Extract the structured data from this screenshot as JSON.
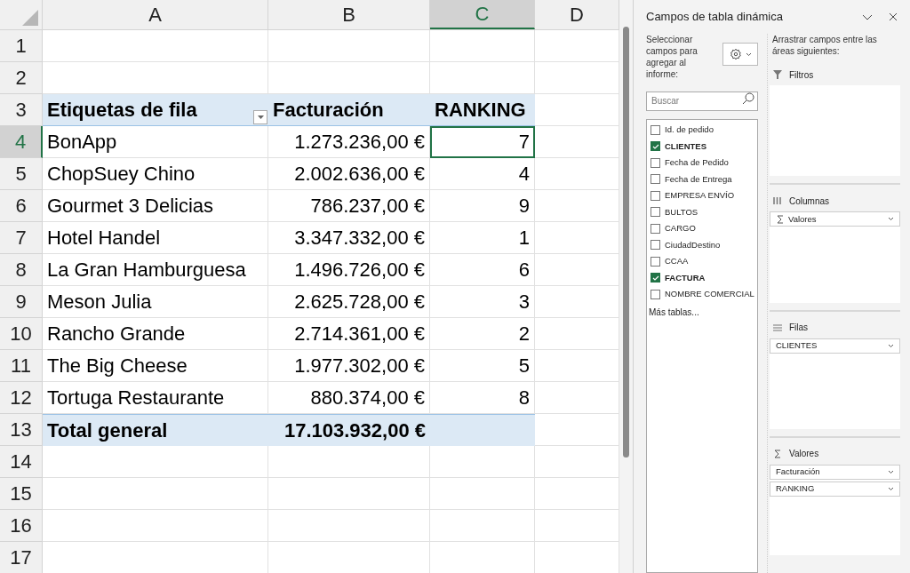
{
  "sheet": {
    "columns": [
      {
        "label": "A",
        "selected": false
      },
      {
        "label": "B",
        "selected": false
      },
      {
        "label": "C",
        "selected": true
      },
      {
        "label": "D",
        "selected": false
      }
    ],
    "rows": [
      {
        "number": "1",
        "kind": "empty",
        "selected": false
      },
      {
        "number": "2",
        "kind": "empty",
        "selected": false
      },
      {
        "number": "3",
        "kind": "header",
        "selected": false,
        "cells": [
          "Etiquetas de fila",
          "Facturación",
          "RANKING"
        ]
      },
      {
        "number": "4",
        "kind": "data",
        "selected": true,
        "cells": [
          "BonApp",
          "1.273.236,00 €",
          "7"
        ]
      },
      {
        "number": "5",
        "kind": "data",
        "selected": false,
        "cells": [
          "ChopSuey Chino",
          "2.002.636,00 €",
          "4"
        ]
      },
      {
        "number": "6",
        "kind": "data",
        "selected": false,
        "cells": [
          "Gourmet 3 Delicias",
          "786.237,00 €",
          "9"
        ]
      },
      {
        "number": "7",
        "kind": "data",
        "selected": false,
        "cells": [
          "Hotel Handel",
          "3.347.332,00 €",
          "1"
        ]
      },
      {
        "number": "8",
        "kind": "data",
        "selected": false,
        "cells": [
          "La Gran Hamburguesa",
          "1.496.726,00 €",
          "6"
        ]
      },
      {
        "number": "9",
        "kind": "data",
        "selected": false,
        "cells": [
          "Meson Julia",
          "2.625.728,00 €",
          "3"
        ]
      },
      {
        "number": "10",
        "kind": "data",
        "selected": false,
        "cells": [
          "Rancho Grande",
          "2.714.361,00 €",
          "2"
        ]
      },
      {
        "number": "11",
        "kind": "data",
        "selected": false,
        "cells": [
          "The Big Cheese",
          "1.977.302,00 €",
          "5"
        ]
      },
      {
        "number": "12",
        "kind": "data",
        "selected": false,
        "cells": [
          "Tortuga Restaurante",
          "880.374,00 €",
          "8"
        ]
      },
      {
        "number": "13",
        "kind": "total",
        "selected": false,
        "cells": [
          "Total general",
          "17.103.932,00 €",
          ""
        ]
      },
      {
        "number": "14",
        "kind": "empty",
        "selected": false
      },
      {
        "number": "15",
        "kind": "empty",
        "selected": false
      },
      {
        "number": "16",
        "kind": "empty",
        "selected": false
      },
      {
        "number": "17",
        "kind": "empty",
        "selected": false
      }
    ]
  },
  "pivot_pane": {
    "title": "Campos de tabla dinámica",
    "select_prompt": "Seleccionar campos para agregar al informe:",
    "search": {
      "placeholder": "Buscar"
    },
    "fields": [
      {
        "label": "Id. de pedido",
        "checked": false
      },
      {
        "label": "CLIENTES",
        "checked": true
      },
      {
        "label": "Fecha de Pedido",
        "checked": false
      },
      {
        "label": "Fecha de Entrega",
        "checked": false
      },
      {
        "label": "EMPRESA ENVÍO",
        "checked": false
      },
      {
        "label": "BULTOS",
        "checked": false
      },
      {
        "label": "CARGO",
        "checked": false
      },
      {
        "label": "CiudadDestino",
        "checked": false
      },
      {
        "label": "CCAA",
        "checked": false
      },
      {
        "label": "FACTURA",
        "checked": true
      },
      {
        "label": "NOMBRE COMERCIAL",
        "checked": false
      }
    ],
    "more_tables": "Más tablas...",
    "drag_prompt": "Arrastrar campos entre las áreas siguientes:",
    "areas": [
      {
        "kind": "filters",
        "title": "Filtros"
      },
      {
        "kind": "columns",
        "title": "Columnas",
        "items": [
          {
            "label": "Valores",
            "kind": "values"
          }
        ]
      },
      {
        "kind": "rows",
        "title": "Filas",
        "items": [
          {
            "label": "CLIENTES",
            "kind": "field"
          }
        ]
      },
      {
        "kind": "values",
        "title": "Valores",
        "items": [
          {
            "label": "Facturación",
            "kind": "field"
          },
          {
            "label": "RANKING",
            "kind": "field"
          }
        ]
      }
    ]
  }
}
